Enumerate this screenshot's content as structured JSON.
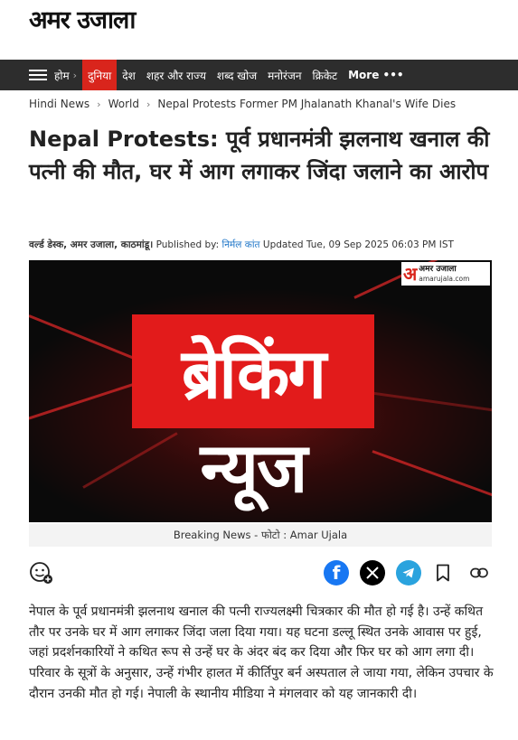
{
  "header": {
    "logo": "अमर उजाला"
  },
  "nav": {
    "home": "होम",
    "items": [
      "दुनिया",
      "देश",
      "शहर और राज्य",
      "शब्द खोज",
      "मनोरंजन",
      "क्रिकेट"
    ],
    "more": "More •••"
  },
  "breadcrumb": [
    "Hindi News",
    "World",
    "Nepal Protests Former PM Jhalanath Khanal's Wife Dies"
  ],
  "article": {
    "headline": "Nepal Protests: पूर्व प्रधानमंत्री झलनाथ खनाल की पत्नी की मौत, घर में आग लगाकर जिंदा जलाने का आरोप",
    "byline_desk": "वर्ल्ड डेस्क, अमर उजाला, काठमांडू।",
    "published_by_label": "Published by:",
    "author": "निर्मल कांत",
    "updated": "Updated Tue, 09 Sep 2025 06:03 PM IST",
    "hero": {
      "word1": "ब्रेकिंग",
      "word2": "न्यूज",
      "brand_name": "अमर उजाला",
      "brand_url": "amarujala.com",
      "brand_letter": "अ"
    },
    "caption": "Breaking News - फोटो : Amar Ujala",
    "body": "नेपाल के पूर्व प्रधानमंत्री झलनाथ खनाल की पत्नी राज्यलक्ष्मी चित्रकार की मौत हो गई है। उन्हें कथित तौर पर उनके घर में आग लगाकर जिंदा जला दिया गया। यह घटना डल्लू स्थित उनके आवास पर हुई, जहां प्रदर्शनकारियों ने कथित रूप से उन्हें घर के अंदर बंद कर दिया और फिर घर को आग लगा दी। परिवार के सूत्रों के अनुसार, उन्हें गंभीर हालत में कीर्तिपुर बर्न अस्पताल ले जाया गया, लेकिन उपचार के दौरान उनकी मौत हो गई। नेपाली के स्थानीय मीडिया ने मंगलवार को यह जानकारी दी।"
  },
  "share": {
    "icons": [
      "emoji-add-icon",
      "facebook-icon",
      "x-icon",
      "telegram-icon",
      "bookmark-icon",
      "link-icon"
    ]
  },
  "colors": {
    "nav_bg": "#2d2d2d",
    "nav_active": "#d9251c",
    "author_link": "#1a73c7",
    "facebook": "#1877f2",
    "telegram": "#2aa3de"
  }
}
